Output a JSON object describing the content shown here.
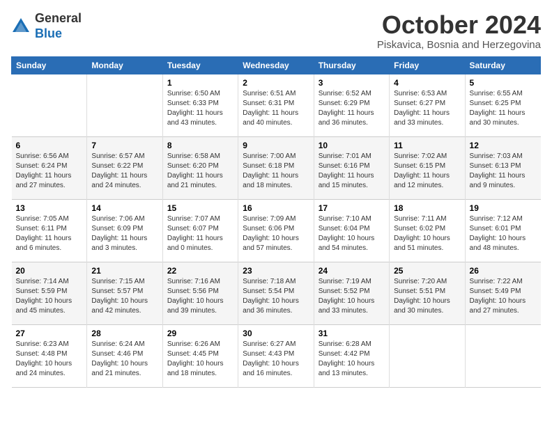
{
  "header": {
    "logo_general": "General",
    "logo_blue": "Blue",
    "month": "October 2024",
    "location": "Piskavica, Bosnia and Herzegovina"
  },
  "days_of_week": [
    "Sunday",
    "Monday",
    "Tuesday",
    "Wednesday",
    "Thursday",
    "Friday",
    "Saturday"
  ],
  "weeks": [
    [
      {
        "day": "",
        "info": ""
      },
      {
        "day": "",
        "info": ""
      },
      {
        "day": "1",
        "info": "Sunrise: 6:50 AM\nSunset: 6:33 PM\nDaylight: 11 hours and 43 minutes."
      },
      {
        "day": "2",
        "info": "Sunrise: 6:51 AM\nSunset: 6:31 PM\nDaylight: 11 hours and 40 minutes."
      },
      {
        "day": "3",
        "info": "Sunrise: 6:52 AM\nSunset: 6:29 PM\nDaylight: 11 hours and 36 minutes."
      },
      {
        "day": "4",
        "info": "Sunrise: 6:53 AM\nSunset: 6:27 PM\nDaylight: 11 hours and 33 minutes."
      },
      {
        "day": "5",
        "info": "Sunrise: 6:55 AM\nSunset: 6:25 PM\nDaylight: 11 hours and 30 minutes."
      }
    ],
    [
      {
        "day": "6",
        "info": "Sunrise: 6:56 AM\nSunset: 6:24 PM\nDaylight: 11 hours and 27 minutes."
      },
      {
        "day": "7",
        "info": "Sunrise: 6:57 AM\nSunset: 6:22 PM\nDaylight: 11 hours and 24 minutes."
      },
      {
        "day": "8",
        "info": "Sunrise: 6:58 AM\nSunset: 6:20 PM\nDaylight: 11 hours and 21 minutes."
      },
      {
        "day": "9",
        "info": "Sunrise: 7:00 AM\nSunset: 6:18 PM\nDaylight: 11 hours and 18 minutes."
      },
      {
        "day": "10",
        "info": "Sunrise: 7:01 AM\nSunset: 6:16 PM\nDaylight: 11 hours and 15 minutes."
      },
      {
        "day": "11",
        "info": "Sunrise: 7:02 AM\nSunset: 6:15 PM\nDaylight: 11 hours and 12 minutes."
      },
      {
        "day": "12",
        "info": "Sunrise: 7:03 AM\nSunset: 6:13 PM\nDaylight: 11 hours and 9 minutes."
      }
    ],
    [
      {
        "day": "13",
        "info": "Sunrise: 7:05 AM\nSunset: 6:11 PM\nDaylight: 11 hours and 6 minutes."
      },
      {
        "day": "14",
        "info": "Sunrise: 7:06 AM\nSunset: 6:09 PM\nDaylight: 11 hours and 3 minutes."
      },
      {
        "day": "15",
        "info": "Sunrise: 7:07 AM\nSunset: 6:07 PM\nDaylight: 11 hours and 0 minutes."
      },
      {
        "day": "16",
        "info": "Sunrise: 7:09 AM\nSunset: 6:06 PM\nDaylight: 10 hours and 57 minutes."
      },
      {
        "day": "17",
        "info": "Sunrise: 7:10 AM\nSunset: 6:04 PM\nDaylight: 10 hours and 54 minutes."
      },
      {
        "day": "18",
        "info": "Sunrise: 7:11 AM\nSunset: 6:02 PM\nDaylight: 10 hours and 51 minutes."
      },
      {
        "day": "19",
        "info": "Sunrise: 7:12 AM\nSunset: 6:01 PM\nDaylight: 10 hours and 48 minutes."
      }
    ],
    [
      {
        "day": "20",
        "info": "Sunrise: 7:14 AM\nSunset: 5:59 PM\nDaylight: 10 hours and 45 minutes."
      },
      {
        "day": "21",
        "info": "Sunrise: 7:15 AM\nSunset: 5:57 PM\nDaylight: 10 hours and 42 minutes."
      },
      {
        "day": "22",
        "info": "Sunrise: 7:16 AM\nSunset: 5:56 PM\nDaylight: 10 hours and 39 minutes."
      },
      {
        "day": "23",
        "info": "Sunrise: 7:18 AM\nSunset: 5:54 PM\nDaylight: 10 hours and 36 minutes."
      },
      {
        "day": "24",
        "info": "Sunrise: 7:19 AM\nSunset: 5:52 PM\nDaylight: 10 hours and 33 minutes."
      },
      {
        "day": "25",
        "info": "Sunrise: 7:20 AM\nSunset: 5:51 PM\nDaylight: 10 hours and 30 minutes."
      },
      {
        "day": "26",
        "info": "Sunrise: 7:22 AM\nSunset: 5:49 PM\nDaylight: 10 hours and 27 minutes."
      }
    ],
    [
      {
        "day": "27",
        "info": "Sunrise: 6:23 AM\nSunset: 4:48 PM\nDaylight: 10 hours and 24 minutes."
      },
      {
        "day": "28",
        "info": "Sunrise: 6:24 AM\nSunset: 4:46 PM\nDaylight: 10 hours and 21 minutes."
      },
      {
        "day": "29",
        "info": "Sunrise: 6:26 AM\nSunset: 4:45 PM\nDaylight: 10 hours and 18 minutes."
      },
      {
        "day": "30",
        "info": "Sunrise: 6:27 AM\nSunset: 4:43 PM\nDaylight: 10 hours and 16 minutes."
      },
      {
        "day": "31",
        "info": "Sunrise: 6:28 AM\nSunset: 4:42 PM\nDaylight: 10 hours and 13 minutes."
      },
      {
        "day": "",
        "info": ""
      },
      {
        "day": "",
        "info": ""
      }
    ]
  ]
}
